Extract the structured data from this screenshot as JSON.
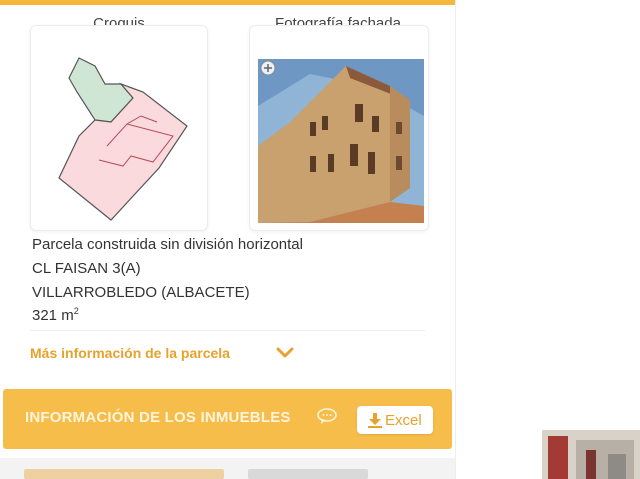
{
  "images": {
    "sketch_label": "Croquis",
    "photo_label": "Fotografía fachada"
  },
  "parcel": {
    "type": "Parcela construida sin división horizontal",
    "address": "CL FAISAN 3(A)",
    "city": "VILLARROBLEDO (ALBACETE)",
    "area_value": "321 m",
    "area_exp": "2"
  },
  "more_info": {
    "label": "Más información de la parcela",
    "icon": "chevron-down-icon"
  },
  "properties_bar": {
    "title": "INFORMACIÓN DE LOS INMUEBLES",
    "info_icon": "chat-bubble-icon",
    "excel_label": "Excel",
    "excel_icon": "download-icon"
  },
  "colors": {
    "accent": "#f6bd4a",
    "link": "#e6a22b",
    "parcel_fill": "#fadadd",
    "parcel_green": "#cfe6d5"
  }
}
